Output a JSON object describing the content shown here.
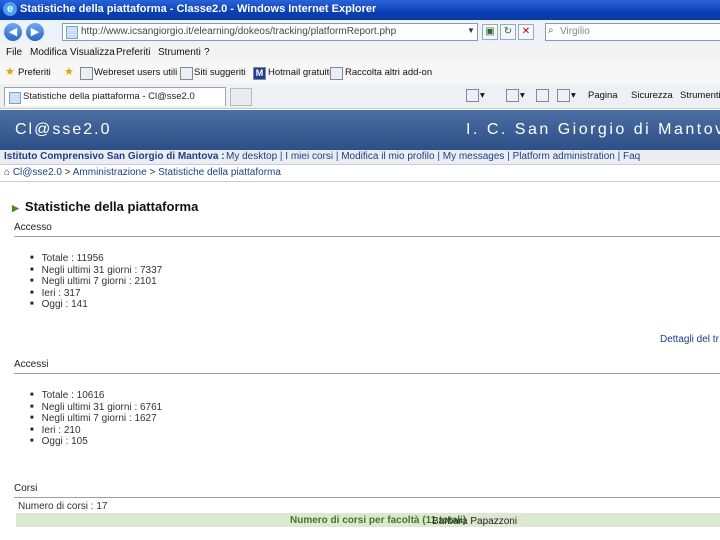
{
  "window": {
    "title": "Statistiche della piattaforma - Classe2.0 - Windows Internet Explorer"
  },
  "address": {
    "url": "http://www.icsangiorgio.it/elearning/dokeos/tracking/platformReport.php"
  },
  "search": {
    "placeholder": "Virgilio"
  },
  "menu": [
    "File",
    "Modifica",
    "Visualizza",
    "Preferiti",
    "Strumenti",
    "?"
  ],
  "favorites": {
    "label": "Preferiti",
    "items": [
      "Webreset users utili",
      "Siti suggeriti",
      "Hotmail gratuito",
      "Raccolta altri add-on"
    ]
  },
  "tab": {
    "label": "Statistiche della piattaforma - Cl@sse2.0"
  },
  "commandbar": {
    "page": "Pagina",
    "safety": "Sicurezza",
    "tools": "Strumenti"
  },
  "site": {
    "logo": "Cl@sse2.0",
    "school": "I. C. San Giorgio di Mantova",
    "institution": "Istituto Comprensivo San Giorgio di Mantova :",
    "nav_links": "My desktop | I miei corsi | Modifica il mio profilo | My messages | Platform administration | Faq"
  },
  "breadcrumb": {
    "home": "Cl@sse2.0",
    "sep": ">",
    "admin": "Amministrazione",
    "current": "Statistiche della piattaforma"
  },
  "page_title": "Statistiche della piattaforma",
  "sections": {
    "accesso": {
      "title": "Accesso",
      "items": [
        "Totale : 11956",
        "Negli ultimi 31 giorni : 7337",
        "Negli ultimi 7 giorni : 2101",
        "Ieri : 317",
        "Oggi : 141"
      ]
    },
    "dettagli_link": "Dettagli del tr",
    "accessi": {
      "title": "Accessi",
      "items": [
        "Totale : 10616",
        "Negli ultimi 31 giorni : 6761",
        "Negli ultimi 7 giorni : 1627",
        "Ieri : 210",
        "Oggi : 105"
      ]
    },
    "corsi": {
      "title": "Corsi",
      "count": "Numero di corsi : 17",
      "table_header": "Numero di corsi per facoltà (11 totali)"
    }
  },
  "caption": "Barbara Papazzoni"
}
